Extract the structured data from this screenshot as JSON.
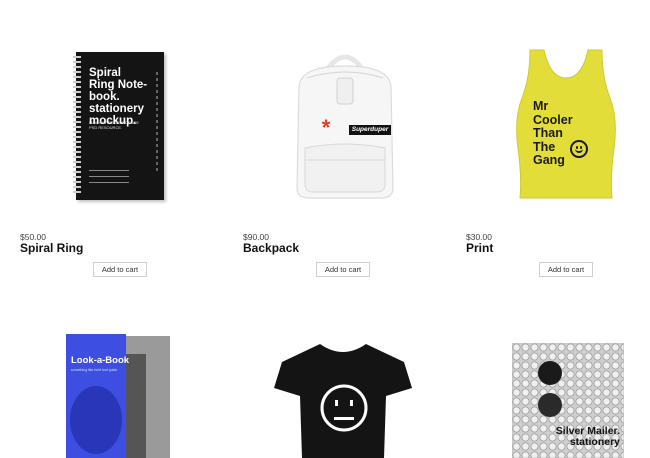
{
  "products": [
    {
      "id": "spiral-ring",
      "price": "$50.00",
      "name": "Spiral Ring",
      "button": "Add to cart",
      "image_text": {
        "title": "Spiral Ring Note-book. stationery mockup.",
        "subtitle": "MAIL CORRESPONDENCE PSD RESOURCE."
      }
    },
    {
      "id": "backpack",
      "price": "$90.00",
      "name": "Backpack",
      "button": "Add to cart",
      "image_text": {
        "tag": "Superduper",
        "mark": "*"
      }
    },
    {
      "id": "print",
      "price": "$30.00",
      "name": "Print",
      "button": "Add to cart",
      "image_text": {
        "lines": [
          "Mr",
          "Cooler",
          "Than",
          "The",
          "Gang"
        ]
      }
    },
    {
      "id": "look-a-book",
      "image_text": {
        "title": "Look-a-Book",
        "subtitle": "something like bold font guide"
      }
    },
    {
      "id": "t-shirt",
      "image_text": {}
    },
    {
      "id": "silver-mailer",
      "image_text": {
        "title": "Silver Mailer. stationery"
      }
    }
  ],
  "colors": {
    "background": "#ffffff",
    "tank_yellow": "#e3dd3a",
    "book_blue": "#3d4fe0",
    "backpack_tag": "#111111",
    "asterisk_red": "#e53a24"
  }
}
